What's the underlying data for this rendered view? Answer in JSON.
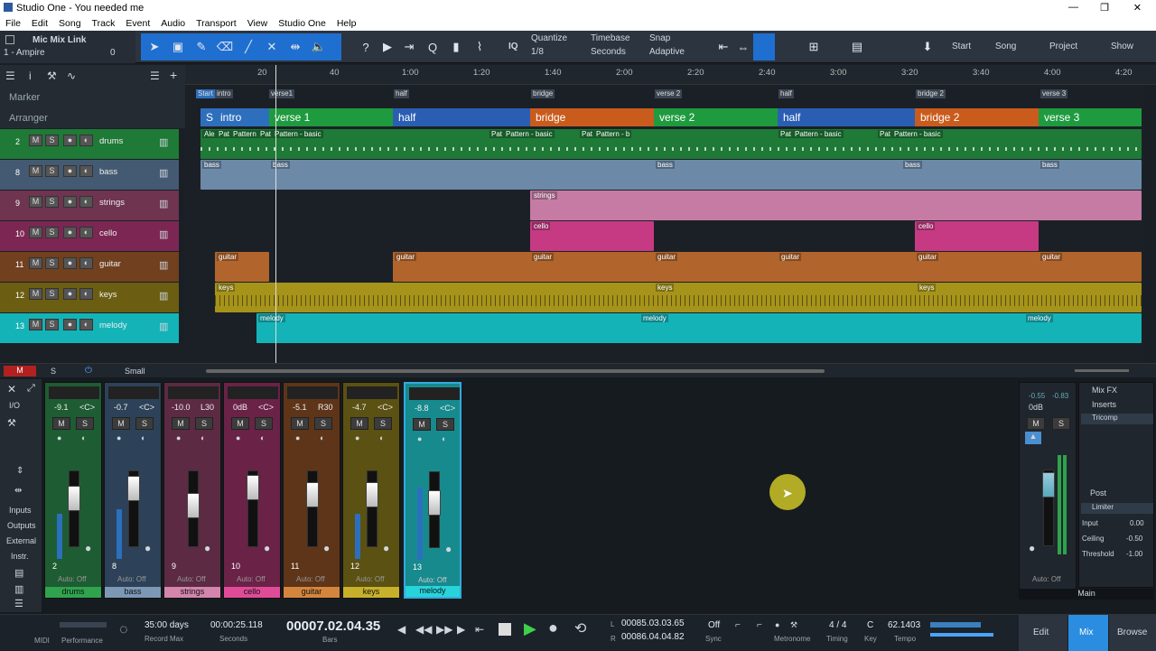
{
  "window": {
    "title": "Studio One - You needed me",
    "controls": [
      "—",
      "❐",
      "✕"
    ]
  },
  "menu": [
    "File",
    "Edit",
    "Song",
    "Track",
    "Event",
    "Audio",
    "Transport",
    "View",
    "Studio One",
    "Help"
  ],
  "toolbar": {
    "device": "Mic Mix Link",
    "device_sub": "1 - Ampire",
    "device_val": "0",
    "iq": "IQ",
    "quantize_label": "Quantize",
    "quantize_val": "1/8",
    "timebase_label": "Timebase",
    "timebase_val": "Seconds",
    "snap_label": "Snap",
    "snap_val": "Adaptive",
    "start": "Start",
    "song": "Song",
    "project": "Project",
    "show": "Show"
  },
  "ruler": [
    "20",
    "40",
    "1:00",
    "1:20",
    "1:40",
    "2:00",
    "2:20",
    "2:40",
    "3:00",
    "3:20",
    "3:40",
    "4:00",
    "4:20"
  ],
  "lanes": {
    "marker": "Marker",
    "arranger": "Arranger"
  },
  "markers": [
    "Start",
    "intro",
    "verse1",
    "half",
    "bridge",
    "verse 2",
    "half",
    "bridge 2",
    "verse 3"
  ],
  "arranger": [
    {
      "name": "S",
      "color": "#2e6fbd"
    },
    {
      "name": "intro",
      "color": "#2e6fbd"
    },
    {
      "name": "verse 1",
      "color": "#1f9b3f"
    },
    {
      "name": "half",
      "color": "#2a5eb3"
    },
    {
      "name": "bridge",
      "color": "#c95b1c"
    },
    {
      "name": "verse 2",
      "color": "#1f9b3f"
    },
    {
      "name": "half",
      "color": "#2a5eb3"
    },
    {
      "name": "bridge 2",
      "color": "#c95b1c"
    },
    {
      "name": "verse 3",
      "color": "#1f9b3f"
    }
  ],
  "tracks": [
    {
      "num": "2",
      "name": "drums",
      "color": "#1e7a36",
      "clips": [
        "Ale",
        "Pat",
        "Pattern",
        "Pat",
        "Pattern - basic",
        "Pat",
        "Pattern - basic",
        "Pat",
        "Pattern - b",
        "Pat",
        "Pattern - basic",
        "Pat",
        "Pattern - basic"
      ]
    },
    {
      "num": "8",
      "name": "bass",
      "color": "#6c8aa8",
      "clips": [
        "bass",
        "bass",
        "bass",
        "bass",
        "bass"
      ]
    },
    {
      "num": "9",
      "name": "strings",
      "color": "#a3527a",
      "clips": [
        "strings"
      ]
    },
    {
      "num": "10",
      "name": "cello",
      "color": "#c63a83",
      "clips": [
        "cello",
        "cello"
      ]
    },
    {
      "num": "11",
      "name": "guitar",
      "color": "#b1652c",
      "clips": [
        "guitar",
        "guitar",
        "guitar",
        "guitar",
        "guitar",
        "guitar",
        "guitar"
      ]
    },
    {
      "num": "12",
      "name": "keys",
      "color": "#a6931a",
      "clips": [
        "keys",
        "keys",
        "keys"
      ]
    },
    {
      "num": "13",
      "name": "melody",
      "color": "#14b3b8",
      "clips": [
        "melody",
        "melody",
        "melody"
      ]
    }
  ],
  "track_buttons": {
    "m": "M",
    "s": "S"
  },
  "bottom_bar": {
    "m": "M",
    "s": "S",
    "size": "Small"
  },
  "mixer": {
    "left_labels": [
      "I/O",
      "Inputs",
      "Outputs",
      "External",
      "Instr."
    ],
    "channels": [
      {
        "num": "2",
        "name": "drums",
        "val": "-9.1",
        "pan": "<C>",
        "color": "#1e7a36"
      },
      {
        "num": "8",
        "name": "bass",
        "val": "-0.7",
        "pan": "<C>",
        "color": "#6c8aa8"
      },
      {
        "num": "9",
        "name": "strings",
        "val": "-10.0",
        "pan": "L30",
        "color": "#a3527a"
      },
      {
        "num": "10",
        "name": "cello",
        "val": "0dB",
        "pan": "<C>",
        "color": "#c63a83"
      },
      {
        "num": "11",
        "name": "guitar",
        "val": "-5.1",
        "pan": "R30",
        "color": "#b1652c"
      },
      {
        "num": "12",
        "name": "keys",
        "val": "-4.7",
        "pan": "<C>",
        "color": "#a6931a"
      },
      {
        "num": "13",
        "name": "melody",
        "val": "-8.8",
        "pan": "<C>",
        "color": "#14b3b8"
      }
    ],
    "auto": "Auto: Off",
    "scale": [
      "10",
      "6",
      "0",
      "-6",
      "-12",
      "-24",
      "-36",
      "-48",
      "-72"
    ]
  },
  "main": {
    "levels": [
      "-0.55",
      "-0.83"
    ],
    "db": "0dB",
    "m": "M",
    "s": "S",
    "auto": "Auto: Off",
    "name": "Main",
    "mixfx": "Mix FX",
    "inserts": "Inserts",
    "insert1": "Tricomp",
    "post": "Post",
    "post1": "Limiter",
    "params": [
      {
        "k": "Input",
        "v": "0.00"
      },
      {
        "k": "Ceiling",
        "v": "-0.50"
      },
      {
        "k": "Threshold",
        "v": "-1.00"
      }
    ]
  },
  "transport": {
    "midi": "MIDI",
    "performance": "Performance",
    "days": "35:00 days",
    "record_max": "Record Max",
    "seconds_val": "00:00:25.118",
    "seconds": "Seconds",
    "bars_val": "00007.02.04.35",
    "bars": "Bars",
    "l": "L",
    "l_val": "00085.03.03.65",
    "r": "R",
    "r_val": "00086.04.04.82",
    "sync_val": "Off",
    "sync": "Sync",
    "metronome": "Metronome",
    "timing_val": "4 / 4",
    "timing": "Timing",
    "key_val": "C",
    "key": "Key",
    "tempo_val": "62.1403",
    "tempo": "Tempo",
    "edit": "Edit",
    "mix": "Mix",
    "browse": "Browse"
  }
}
